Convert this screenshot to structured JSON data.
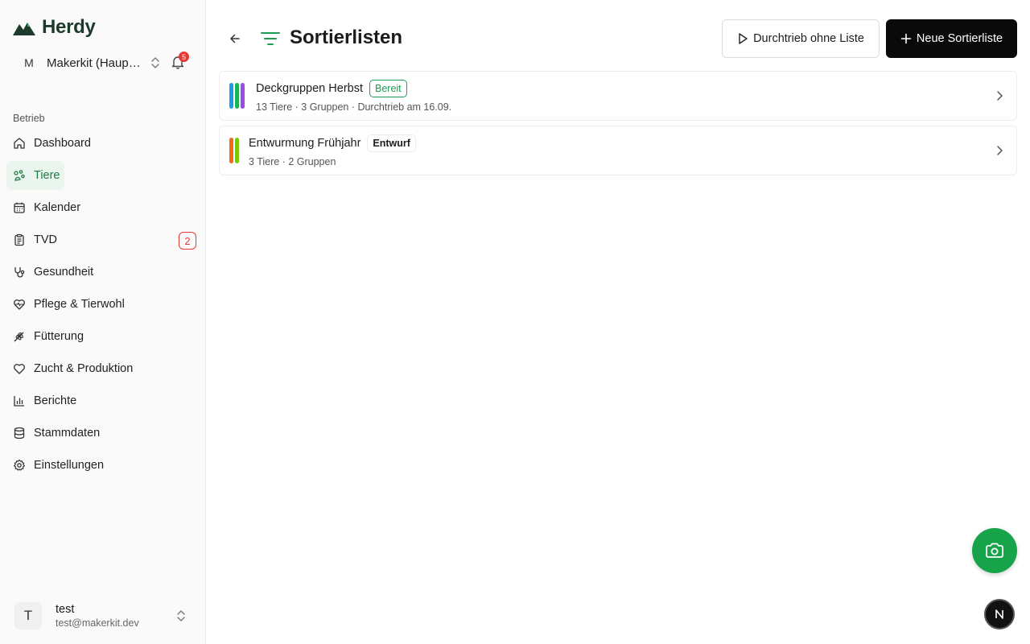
{
  "app": {
    "logo_text": "Herdy",
    "brand_color": "#1f7a44"
  },
  "org": {
    "avatar_letter": "M",
    "name": "Makerkit (Haupt…"
  },
  "notifications": {
    "count": "5"
  },
  "sidebar": {
    "section_label": "Betrieb",
    "items": [
      {
        "label": "Dashboard",
        "icon": "home-icon"
      },
      {
        "label": "Tiere",
        "icon": "animals-icon",
        "active": true
      },
      {
        "label": "Kalender",
        "icon": "calendar-icon"
      },
      {
        "label": "TVD",
        "icon": "clipboard-icon",
        "count": "2"
      },
      {
        "label": "Gesundheit",
        "icon": "stethoscope-icon"
      },
      {
        "label": "Pflege & Tierwohl",
        "icon": "heart-pulse-icon"
      },
      {
        "label": "Fütterung",
        "icon": "wheat-icon"
      },
      {
        "label": "Zucht & Produktion",
        "icon": "heart-icon"
      },
      {
        "label": "Berichte",
        "icon": "bar-chart-icon"
      },
      {
        "label": "Stammdaten",
        "icon": "database-icon"
      },
      {
        "label": "Einstellungen",
        "icon": "gear-icon"
      }
    ]
  },
  "user": {
    "avatar_letter": "T",
    "name": "test",
    "email": "test@makerkit.dev"
  },
  "header": {
    "title": "Sortierlisten",
    "secondary_button": "Durchtrieb ohne Liste",
    "primary_button": "Neue Sortierliste"
  },
  "lists": [
    {
      "title": "Deckgruppen Herbst",
      "status": "Bereit",
      "meta": "13 Tiere · 3 Gruppen · Durchtrieb am 16.09.",
      "colors": [
        "#1e9be8",
        "#19b35a",
        "#9b4be6"
      ]
    },
    {
      "title": "Entwurmung Frühjahr",
      "status": "Entwurf",
      "meta": "3 Tiere · 2 Gruppen",
      "colors": [
        "#f26b1d",
        "#7ac70c"
      ]
    }
  ],
  "fab": {
    "icon": "camera-icon",
    "color": "#16a34a"
  },
  "dev_badge": {
    "letter": "N"
  }
}
